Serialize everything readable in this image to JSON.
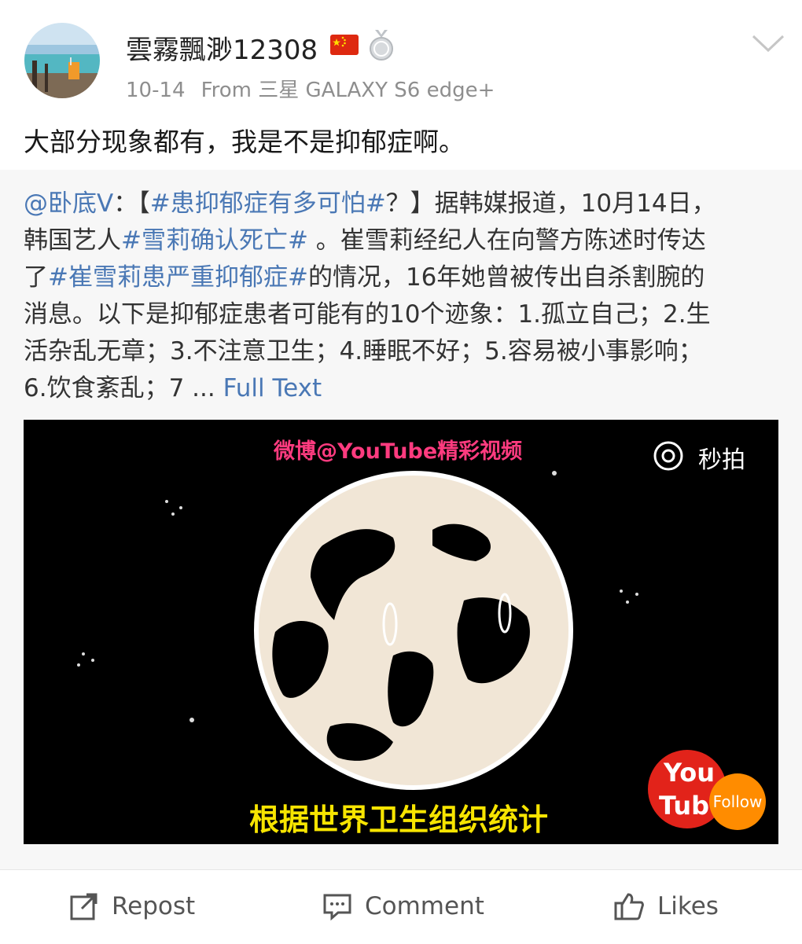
{
  "post": {
    "username": "雲霧飄渺12308",
    "date": "10-14",
    "source": "From 三星 GALAXY S6 edge+",
    "text": "大部分现象都有，我是不是抑郁症啊。",
    "badges": [
      "china-flag-icon",
      "medal-icon"
    ]
  },
  "repost": {
    "lines": [
      [
        {
          "text": "@卧底V",
          "link": true
        },
        {
          "text": "：【",
          "link": false
        },
        {
          "text": "#患抑郁症有多可怕#",
          "link": true
        },
        {
          "text": "？】据韩媒报道，10月14日，",
          "link": false
        }
      ],
      [
        {
          "text": "韩国艺人",
          "link": false
        },
        {
          "text": "#雪莉确认死亡#",
          "link": true
        },
        {
          "text": " 。崔雪莉经纪人在向警方陈述时传达",
          "link": false
        }
      ],
      [
        {
          "text": "了",
          "link": false
        },
        {
          "text": "#崔雪莉患严重抑郁症#",
          "link": true
        },
        {
          "text": "的情况，16年她曾被传出自杀割腕的",
          "link": false
        }
      ],
      [
        {
          "text": "消息。以下是抑郁症患者可能有的10个迹象：1.孤立自己；2.生",
          "link": false
        }
      ],
      [
        {
          "text": "活杂乱无章；3.不注意卫生；4.睡眠不好；5.容易被小事影响；",
          "link": false
        }
      ],
      [
        {
          "text": "6.饮食紊乱；7 ... ",
          "link": false
        },
        {
          "text": "Full Text",
          "link": true
        }
      ]
    ],
    "video": {
      "watermark": "微博@YouTube精彩视频",
      "miaopai_label": "秒拍",
      "subtitle": "根据世界卫生组织统计",
      "youtube_badge_top": "You",
      "youtube_badge_bottom": "Tube",
      "follow_label": "Follow"
    }
  },
  "actions": {
    "repost_label": "Repost",
    "comment_label": "Comment",
    "likes_label": "Likes"
  },
  "colors": {
    "link": "#4a78b5",
    "meta": "#8e8e8e",
    "repost_bg": "#f7f7f7",
    "subtitle": "#f7e400",
    "watermark": "#ff3b7f"
  }
}
